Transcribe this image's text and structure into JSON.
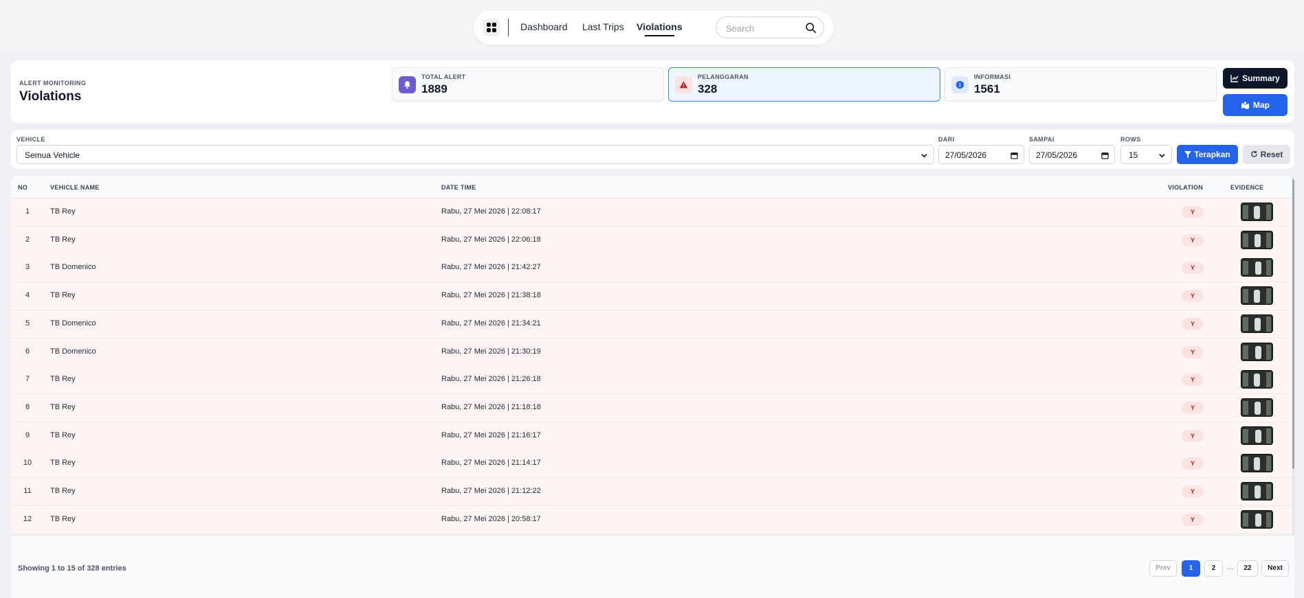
{
  "nav": {
    "links": [
      {
        "label": "Dashboard"
      },
      {
        "label": "Last Trips"
      },
      {
        "label": "Violations"
      }
    ],
    "search_placeholder": "Search"
  },
  "header": {
    "eyebrow": "ALERT MONITORING",
    "title": "Violations",
    "stats": [
      {
        "label": "TOTAL ALERT",
        "value": "1889",
        "icon": "bell-icon",
        "color": "#6d5bd0"
      },
      {
        "label": "PELANGGARAN",
        "value": "328",
        "icon": "warning-icon",
        "color": "#b91c1c"
      },
      {
        "label": "INFORMASI",
        "value": "1561",
        "icon": "info-icon",
        "color": "#2563eb"
      }
    ],
    "summary_label": "Summary",
    "map_label": "Map"
  },
  "filters": {
    "vehicle_label": "VEHICLE",
    "vehicle_value": "Semua Vehicle",
    "from_label": "DARI",
    "from_value": "27/05/2026",
    "to_label": "SAMPAI",
    "to_value": "27/05/2026",
    "rows_label": "ROWS",
    "rows_value": "15",
    "apply_label": "Terapkan",
    "reset_label": "Reset"
  },
  "table": {
    "headers": {
      "no": "NO",
      "vehicle": "VEHICLE NAME",
      "datetime": "DATE TIME",
      "violation": "VIOLATION",
      "evidence": "EVIDENCE"
    },
    "rows": [
      {
        "no": "1",
        "vehicle": "TB Rey",
        "datetime": "Rabu, 27 Mei 2026 | 22:08:17",
        "violation": "Y"
      },
      {
        "no": "2",
        "vehicle": "TB Rey",
        "datetime": "Rabu, 27 Mei 2026 | 22:06:18",
        "violation": "Y"
      },
      {
        "no": "3",
        "vehicle": "TB Domenico",
        "datetime": "Rabu, 27 Mei 2026 | 21:42:27",
        "violation": "Y"
      },
      {
        "no": "4",
        "vehicle": "TB Rey",
        "datetime": "Rabu, 27 Mei 2026 | 21:38:18",
        "violation": "Y"
      },
      {
        "no": "5",
        "vehicle": "TB Domenico",
        "datetime": "Rabu, 27 Mei 2026 | 21:34:21",
        "violation": "Y"
      },
      {
        "no": "6",
        "vehicle": "TB Domenico",
        "datetime": "Rabu, 27 Mei 2026 | 21:30:19",
        "violation": "Y"
      },
      {
        "no": "7",
        "vehicle": "TB Rey",
        "datetime": "Rabu, 27 Mei 2026 | 21:26:18",
        "violation": "Y"
      },
      {
        "no": "8",
        "vehicle": "TB Rey",
        "datetime": "Rabu, 27 Mei 2026 | 21:18:18",
        "violation": "Y"
      },
      {
        "no": "9",
        "vehicle": "TB Rey",
        "datetime": "Rabu, 27 Mei 2026 | 21:16:17",
        "violation": "Y"
      },
      {
        "no": "10",
        "vehicle": "TB Rey",
        "datetime": "Rabu, 27 Mei 2026 | 21:14:17",
        "violation": "Y"
      },
      {
        "no": "11",
        "vehicle": "TB Rey",
        "datetime": "Rabu, 27 Mei 2026 | 21:12:22",
        "violation": "Y"
      },
      {
        "no": "12",
        "vehicle": "TB Rey",
        "datetime": "Rabu, 27 Mei 2026 | 20:58:17",
        "violation": "Y"
      }
    ]
  },
  "footer": {
    "showing": "Showing 1 to 15 of 328 entries",
    "prev": "Prev",
    "pages": [
      "1",
      "2",
      "22"
    ],
    "ellipsis": "...",
    "next": "Next"
  }
}
